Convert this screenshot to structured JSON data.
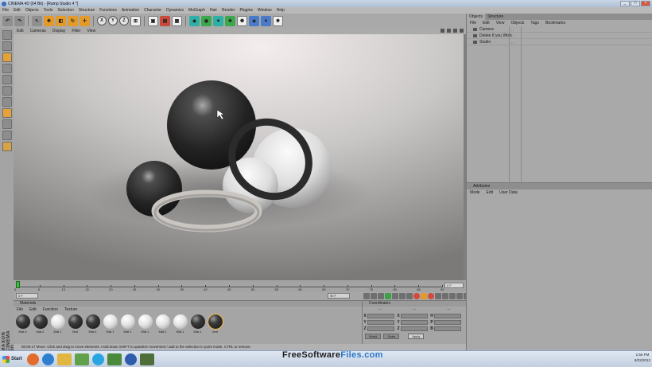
{
  "window": {
    "title": "CINEMA 4D (64 Bit) - [Ramp Studio 4 *]"
  },
  "menubar": [
    "File",
    "Edit",
    "Objects",
    "Tools",
    "Selection",
    "Structure",
    "Functions",
    "Animation",
    "Character",
    "Dynamics",
    "MoGraph",
    "Hair",
    "Render",
    "Plugins",
    "Window",
    "Help"
  ],
  "toolbar": {
    "axis": [
      "X",
      "Y",
      "Z"
    ]
  },
  "viewport": {
    "menu": [
      "Edit",
      "Cameras",
      "Display",
      "Filter",
      "View"
    ]
  },
  "timeline": {
    "ticks": [
      "0",
      "5",
      "10",
      "15",
      "20",
      "25",
      "30",
      "35",
      "40",
      "45",
      "50",
      "55",
      "60",
      "65",
      "70",
      "75",
      "80",
      "85",
      "90"
    ],
    "end_frame": "0 F",
    "current_frame": "0 F",
    "end_field": "90 F"
  },
  "materials": {
    "title": "Materials",
    "menu": [
      "File",
      "Edit",
      "Function",
      "Texture"
    ],
    "items": [
      {
        "label": "Mat.3",
        "style": "dark"
      },
      {
        "label": "Mat.2",
        "style": "dark"
      },
      {
        "label": "Mat.1",
        "style": "light"
      },
      {
        "label": "Mat",
        "style": "dark"
      },
      {
        "label": "Mat.4",
        "style": "dark"
      },
      {
        "label": "Mat.1",
        "style": "light"
      },
      {
        "label": "Mat.1",
        "style": "light"
      },
      {
        "label": "Mat.1",
        "style": "light"
      },
      {
        "label": "Mat.1",
        "style": "light"
      },
      {
        "label": "Mat.1",
        "style": "light"
      },
      {
        "label": "Mat.1",
        "style": "dark"
      },
      {
        "label": "Mat",
        "style": "dark"
      }
    ]
  },
  "coordinates": {
    "title": "Coordinates",
    "rows": [
      {
        "a": "X",
        "b": "X",
        "c": "H"
      },
      {
        "a": "Y",
        "b": "Y",
        "c": "P"
      },
      {
        "a": "Z",
        "b": "Z",
        "c": "B"
      }
    ],
    "mode": "World",
    "scale": "Scale",
    "apply": "Apply"
  },
  "status": {
    "text": "00:00:17  Move: Click and drag to move elements. Hold down SHIFT to quantize movement / add to the selection in point mode, CTRL to remove."
  },
  "objects_panel": {
    "tabs": [
      "Objects",
      "Structure"
    ],
    "menu": [
      "File",
      "Edit",
      "View",
      "Objects",
      "Tags",
      "Bookmarks"
    ],
    "items": [
      "Camera",
      "Delete If you Wish",
      "Studio"
    ]
  },
  "attributes_panel": {
    "title": "Attributes",
    "menu": [
      "Mode",
      "Edit",
      "User Data"
    ]
  },
  "watermark": {
    "part1": "FreeSoftware",
    "part2": "Files.com"
  },
  "taskbar": {
    "start": "Start",
    "time": "1:55 PM",
    "date": "8/22/2012"
  },
  "brand": "MAXON CINEMA 4D"
}
